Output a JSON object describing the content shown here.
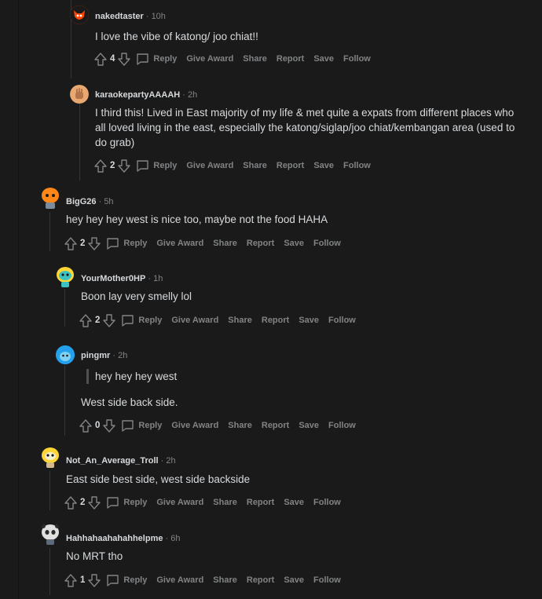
{
  "comments": [
    {
      "user": "nakedtaster",
      "time": "10h",
      "text": "I love the vibe of katong/ joo chiat!!",
      "score": "4",
      "avatar_color": "#ff4500",
      "avatar_glyph": "fox-avatar"
    },
    {
      "user": "karaokepartyAAAAH",
      "time": "2h",
      "text": "I third this! Lived in East majority of my life & met quite a expats from different places who all loved living in the east, especially the katong/siglap/joo chiat/kembangan area (used to do grab)",
      "score": "2",
      "avatar_color": "#c9956b",
      "avatar_glyph": "hand-avatar"
    },
    {
      "user": "BigG26",
      "time": "5h",
      "text": "hey hey hey west is nice too, maybe not the food HAHA",
      "score": "2",
      "avatar_color": "#ff8717",
      "avatar_glyph": "orange-snoo-avatar"
    },
    {
      "user": "YourMother0HP",
      "time": "1h",
      "text": "Boon lay very smelly lol",
      "score": "2",
      "avatar_color": "#ffd635",
      "avatar_glyph": "cyan-snoo-avatar"
    },
    {
      "user": "pingmr",
      "time": "2h",
      "quote": "hey hey hey west",
      "text": "West side back side.",
      "score": "0",
      "avatar_color": "#24a0ed",
      "avatar_glyph": "blue-snoo-avatar"
    },
    {
      "user": "Not_An_Average_Troll",
      "time": "2h",
      "text": "East side best side, west side backside",
      "score": "2",
      "avatar_color": "#ffd635",
      "avatar_glyph": "yellow-snoo-avatar"
    },
    {
      "user": "Hahhahaahahahhelpme",
      "time": "6h",
      "text": "No MRT tho",
      "score": "1",
      "avatar_color": "#e0e0e0",
      "avatar_glyph": "panda-snoo-avatar"
    }
  ],
  "actions": {
    "reply": "Reply",
    "award": "Give Award",
    "share": "Share",
    "report": "Report",
    "save": "Save",
    "follow": "Follow"
  },
  "separator": "·"
}
